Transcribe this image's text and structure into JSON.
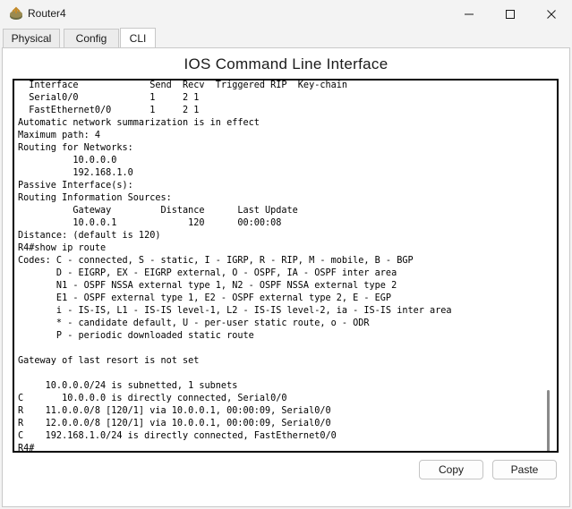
{
  "window": {
    "title": "Router4",
    "icon": "router-icon"
  },
  "tabs": [
    {
      "label": "Physical",
      "active": false
    },
    {
      "label": "Config",
      "active": false
    },
    {
      "label": "CLI",
      "active": true
    }
  ],
  "cli": {
    "heading": "IOS Command Line Interface",
    "lines": [
      "  Interface             Send  Recv  Triggered RIP  Key-chain",
      "  Serial0/0             1     2 1",
      "  FastEthernet0/0       1     2 1",
      "Automatic network summarization is in effect",
      "Maximum path: 4",
      "Routing for Networks:",
      "          10.0.0.0",
      "          192.168.1.0",
      "Passive Interface(s):",
      "Routing Information Sources:",
      "          Gateway         Distance      Last Update",
      "          10.0.0.1             120      00:00:08",
      "Distance: (default is 120)",
      "R4#show ip route",
      "Codes: C - connected, S - static, I - IGRP, R - RIP, M - mobile, B - BGP",
      "       D - EIGRP, EX - EIGRP external, O - OSPF, IA - OSPF inter area",
      "       N1 - OSPF NSSA external type 1, N2 - OSPF NSSA external type 2",
      "       E1 - OSPF external type 1, E2 - OSPF external type 2, E - EGP",
      "       i - IS-IS, L1 - IS-IS level-1, L2 - IS-IS level-2, ia - IS-IS inter area",
      "       * - candidate default, U - per-user static route, o - ODR",
      "       P - periodic downloaded static route",
      "",
      "Gateway of last resort is not set",
      "",
      "     10.0.0.0/24 is subnetted, 1 subnets",
      "C       10.0.0.0 is directly connected, Serial0/0",
      "R    11.0.0.0/8 [120/1] via 10.0.0.1, 00:00:09, Serial0/0",
      "R    12.0.0.0/8 [120/1] via 10.0.0.1, 00:00:09, Serial0/0",
      "C    192.168.1.0/24 is directly connected, FastEthernet0/0",
      "R4#"
    ]
  },
  "buttons": {
    "copy": "Copy",
    "paste": "Paste"
  },
  "window_controls": {
    "minimize": "minimize-icon",
    "maximize": "maximize-icon",
    "close": "close-icon"
  }
}
